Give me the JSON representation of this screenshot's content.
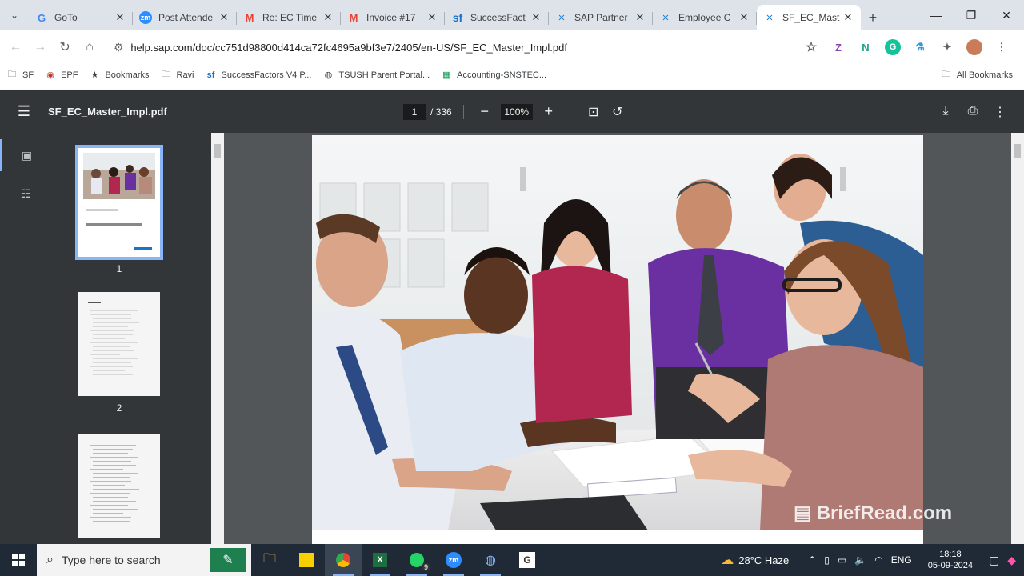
{
  "tabs": [
    {
      "title": "GoTo",
      "icon": "google-icon",
      "active": false
    },
    {
      "title": "Post Attende",
      "icon": "zoom-icon",
      "active": false
    },
    {
      "title": "Re: EC Time",
      "icon": "gmail-icon",
      "active": false
    },
    {
      "title": "Invoice #17",
      "icon": "gmail-icon",
      "active": false
    },
    {
      "title": "SuccessFact",
      "icon": "successfactors-icon",
      "active": false
    },
    {
      "title": "SAP Partner",
      "icon": "sap-icon",
      "active": false
    },
    {
      "title": "Employee C",
      "icon": "sap-icon",
      "active": false
    },
    {
      "title": "SF_EC_Mast",
      "icon": "sap-icon",
      "active": true
    }
  ],
  "address": {
    "url": "help.sap.com/doc/cc751d98800d414ca72fc4695a9bf3e7/2405/en-US/SF_EC_Master_Impl.pdf"
  },
  "bookmarks": [
    {
      "label": "SF",
      "icon": "folder-icon"
    },
    {
      "label": "EPF",
      "icon": "epf-icon"
    },
    {
      "label": "Bookmarks",
      "icon": "star-icon"
    },
    {
      "label": "Ravi",
      "icon": "folder-icon"
    },
    {
      "label": "SuccessFactors V4 P...",
      "icon": "successfactors-icon"
    },
    {
      "label": "TSUSH Parent Portal...",
      "icon": "portal-icon"
    },
    {
      "label": "Accounting-SNSTEC...",
      "icon": "sheets-icon"
    }
  ],
  "bookmarks_all": "All Bookmarks",
  "pdf": {
    "title": "SF_EC_Master_Impl.pdf",
    "page_current": "1",
    "page_total": "/ 336",
    "zoom": "100%",
    "thumb_labels": [
      "1",
      "2"
    ]
  },
  "watermark": "BriefRead.com",
  "taskbar": {
    "search_placeholder": "Type here to search",
    "weather": "28°C  Haze",
    "language": "ENG",
    "time": "18:18",
    "date": "05-09-2024",
    "whatsapp_badge": "9"
  },
  "colors": {
    "tabstrip": "#dee3ea",
    "pdf_toolbar": "#323639",
    "pdf_background": "#525659",
    "thumb_highlight": "#8ab4f8",
    "taskbar": "#1f2a36"
  }
}
